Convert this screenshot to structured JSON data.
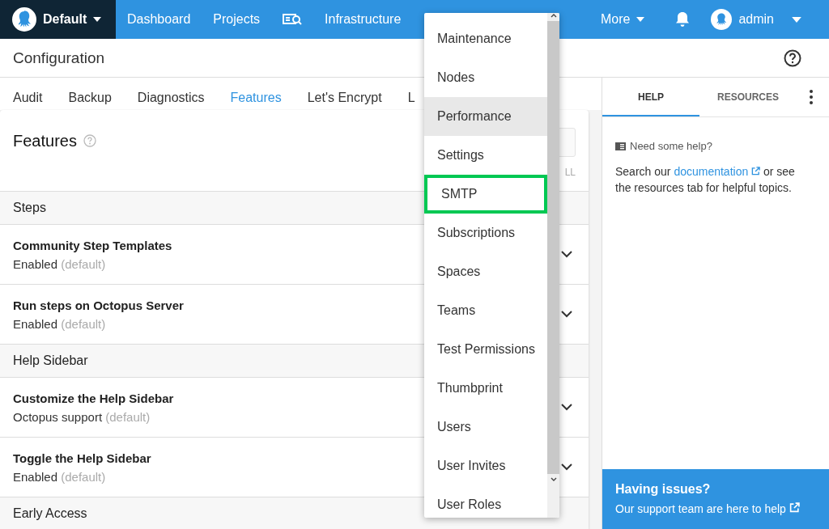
{
  "nav": {
    "brand": "Default",
    "items": [
      {
        "kind": "text",
        "label": "Dashboard"
      },
      {
        "kind": "text",
        "label": "Projects"
      },
      {
        "kind": "icon"
      },
      {
        "kind": "text",
        "label": "Infrastructure"
      }
    ],
    "more": "More",
    "user": "admin"
  },
  "page_title": "Configuration",
  "tabs": [
    {
      "label": "Audit",
      "selected": false
    },
    {
      "label": "Backup",
      "selected": false
    },
    {
      "label": "Diagnostics",
      "selected": false
    },
    {
      "label": "Features",
      "selected": true
    },
    {
      "label": "Let's Encrypt",
      "selected": false
    },
    {
      "label": "L",
      "selected": false
    }
  ],
  "card": {
    "title": "Features",
    "action": "LL",
    "sections": [
      {
        "title": "Steps",
        "features": [
          {
            "name": "Community Step Templates",
            "value": "Enabled",
            "note": "(default)"
          },
          {
            "name": "Run steps on Octopus Server",
            "value": "Enabled",
            "note": "(default)"
          }
        ]
      },
      {
        "title": "Help Sidebar",
        "features": [
          {
            "name": "Customize the Help Sidebar",
            "value": "Octopus support",
            "note": "(default)"
          },
          {
            "name": "Toggle the Help Sidebar",
            "value": "Enabled",
            "note": "(default)"
          }
        ]
      },
      {
        "title": "Early Access"
      }
    ]
  },
  "help": {
    "tabs": [
      {
        "label": "HELP",
        "selected": true
      },
      {
        "label": "RESOURCES",
        "selected": false
      }
    ],
    "heading": "Need some help?",
    "text_before": "Search our",
    "link": "documentation",
    "text_after": "or see the resources tab for helpful topics.",
    "issues_title": "Having issues?",
    "issues_link": "Our support team are here to help"
  },
  "menu": {
    "items": [
      {
        "label": "Maintenance",
        "hovered": false,
        "highlighted": false
      },
      {
        "label": "Nodes",
        "hovered": false,
        "highlighted": false
      },
      {
        "label": "Performance",
        "hovered": true,
        "highlighted": false
      },
      {
        "label": "Settings",
        "hovered": false,
        "highlighted": false
      },
      {
        "label": "SMTP",
        "hovered": false,
        "highlighted": true
      },
      {
        "label": "Subscriptions",
        "hovered": false,
        "highlighted": false
      },
      {
        "label": "Spaces",
        "hovered": false,
        "highlighted": false
      },
      {
        "label": "Teams",
        "hovered": false,
        "highlighted": false
      },
      {
        "label": "Test Permissions",
        "hovered": false,
        "highlighted": false
      },
      {
        "label": "Thumbprint",
        "hovered": false,
        "highlighted": false
      },
      {
        "label": "Users",
        "hovered": false,
        "highlighted": false
      },
      {
        "label": "User Invites",
        "hovered": false,
        "highlighted": false
      },
      {
        "label": "User Roles",
        "hovered": false,
        "highlighted": false
      }
    ]
  }
}
